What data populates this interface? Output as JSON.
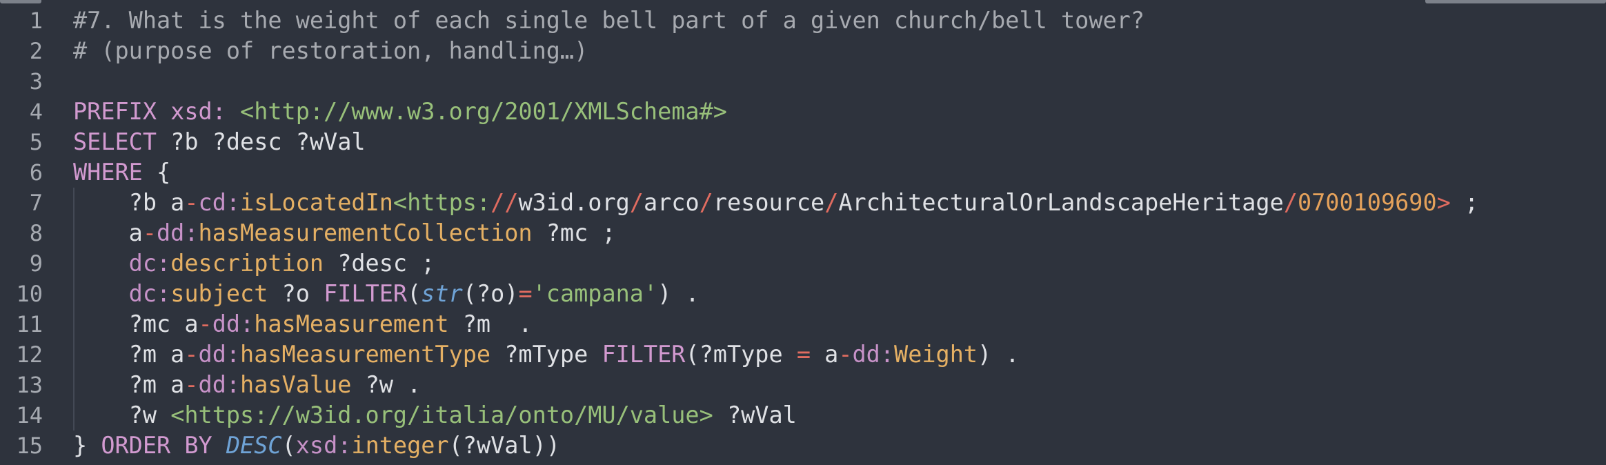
{
  "line_numbers": [
    "1",
    "2",
    "3",
    "4",
    "5",
    "6",
    "7",
    "8",
    "9",
    "10",
    "11",
    "12",
    "13",
    "14",
    "15"
  ],
  "code_lines": [
    [
      {
        "t": "#7. What is the weight of each single bell part of a given church/bell tower?",
        "c": "cm"
      }
    ],
    [
      {
        "t": "# (purpose of restoration, handling…)",
        "c": "cm"
      }
    ],
    [],
    [
      {
        "t": "PREFIX xsd: ",
        "c": "kw"
      },
      {
        "t": "<http://www.w3.org/2001/XMLSchema#>",
        "c": "str"
      }
    ],
    [
      {
        "t": "SELECT",
        "c": "kw"
      },
      {
        "t": " ?b ?desc ?wVal",
        "c": "plain"
      }
    ],
    [
      {
        "t": "WHERE",
        "c": "kw"
      },
      {
        "t": " {",
        "c": "plain"
      }
    ],
    [
      {
        "t": "    ?b a",
        "c": "plain"
      },
      {
        "t": "-",
        "c": "op"
      },
      {
        "t": "cd:",
        "c": "pfx"
      },
      {
        "t": "isLocatedIn",
        "c": "lname"
      },
      {
        "t": "<https:",
        "c": "str"
      },
      {
        "t": "//",
        "c": "op"
      },
      {
        "t": "w3id.org",
        "c": "plain"
      },
      {
        "t": "/",
        "c": "op"
      },
      {
        "t": "arco",
        "c": "plain"
      },
      {
        "t": "/",
        "c": "op"
      },
      {
        "t": "resource",
        "c": "plain"
      },
      {
        "t": "/",
        "c": "op"
      },
      {
        "t": "ArchitecturalOrLandscapeHeritage",
        "c": "plain"
      },
      {
        "t": "/",
        "c": "op"
      },
      {
        "t": "0700109690",
        "c": "num"
      },
      {
        "t": ">",
        "c": "op"
      },
      {
        "t": " ;",
        "c": "plain"
      }
    ],
    [
      {
        "t": "    a",
        "c": "plain"
      },
      {
        "t": "-",
        "c": "op"
      },
      {
        "t": "dd:",
        "c": "pfx"
      },
      {
        "t": "hasMeasurementCollection",
        "c": "lname"
      },
      {
        "t": " ?mc ;",
        "c": "plain"
      }
    ],
    [
      {
        "t": "    dc:",
        "c": "pfx"
      },
      {
        "t": "description",
        "c": "lname"
      },
      {
        "t": " ?desc ;",
        "c": "plain"
      }
    ],
    [
      {
        "t": "    dc:",
        "c": "pfx"
      },
      {
        "t": "subject",
        "c": "lname"
      },
      {
        "t": " ?o ",
        "c": "plain"
      },
      {
        "t": "FILTER",
        "c": "kw"
      },
      {
        "t": "(",
        "c": "plain"
      },
      {
        "t": "str",
        "c": "fn"
      },
      {
        "t": "(?o)",
        "c": "plain"
      },
      {
        "t": "=",
        "c": "op"
      },
      {
        "t": "'campana'",
        "c": "str"
      },
      {
        "t": ") .",
        "c": "plain"
      }
    ],
    [
      {
        "t": "    ?mc a",
        "c": "plain"
      },
      {
        "t": "-",
        "c": "op"
      },
      {
        "t": "dd:",
        "c": "pfx"
      },
      {
        "t": "hasMeasurement",
        "c": "lname"
      },
      {
        "t": " ?m  .",
        "c": "plain"
      }
    ],
    [
      {
        "t": "    ?m a",
        "c": "plain"
      },
      {
        "t": "-",
        "c": "op"
      },
      {
        "t": "dd:",
        "c": "pfx"
      },
      {
        "t": "hasMeasurementType",
        "c": "lname"
      },
      {
        "t": " ?mType ",
        "c": "plain"
      },
      {
        "t": "FILTER",
        "c": "kw"
      },
      {
        "t": "(?mType ",
        "c": "plain"
      },
      {
        "t": "=",
        "c": "op"
      },
      {
        "t": " a",
        "c": "plain"
      },
      {
        "t": "-",
        "c": "op"
      },
      {
        "t": "dd:",
        "c": "pfx"
      },
      {
        "t": "Weight",
        "c": "lname"
      },
      {
        "t": ") .",
        "c": "plain"
      }
    ],
    [
      {
        "t": "    ?m a",
        "c": "plain"
      },
      {
        "t": "-",
        "c": "op"
      },
      {
        "t": "dd:",
        "c": "pfx"
      },
      {
        "t": "hasValue",
        "c": "lname"
      },
      {
        "t": " ?w .",
        "c": "plain"
      }
    ],
    [
      {
        "t": "    ?w ",
        "c": "plain"
      },
      {
        "t": "<https://w3id.org/italia/onto/MU/value>",
        "c": "str"
      },
      {
        "t": " ?wVal",
        "c": "plain"
      }
    ],
    [
      {
        "t": "} ",
        "c": "plain"
      },
      {
        "t": "ORDER BY ",
        "c": "kw"
      },
      {
        "t": "DESC",
        "c": "fn"
      },
      {
        "t": "(",
        "c": "plain"
      },
      {
        "t": "xsd:",
        "c": "pfx"
      },
      {
        "t": "integer",
        "c": "lname"
      },
      {
        "t": "(?wVal))",
        "c": "plain"
      }
    ]
  ]
}
